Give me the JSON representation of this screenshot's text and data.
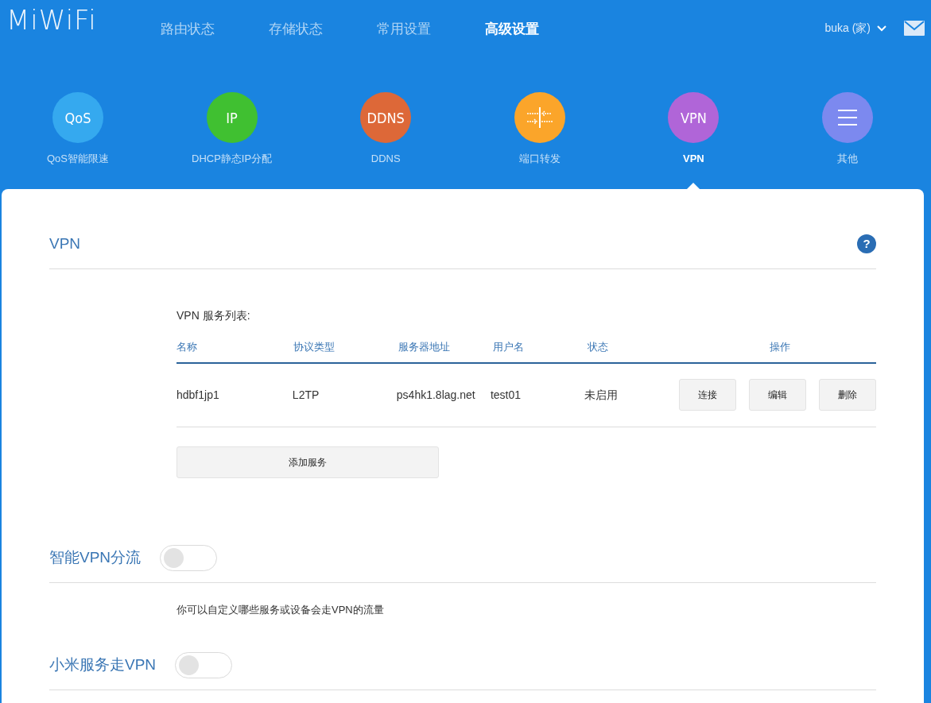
{
  "header": {
    "logo": "MiWiFi",
    "nav": [
      {
        "label": "路由状态",
        "selected": false
      },
      {
        "label": "存储状态",
        "selected": false
      },
      {
        "label": "常用设置",
        "selected": false
      },
      {
        "label": "高级设置",
        "selected": true
      }
    ],
    "user": "buka (家)"
  },
  "features": [
    {
      "kind": "text",
      "glyph": "QoS",
      "label": "QoS智能限速",
      "color": "#35a9ef",
      "selected": false
    },
    {
      "kind": "text",
      "glyph": "IP",
      "label": "DHCP静态IP分配",
      "color": "#40c031",
      "selected": false
    },
    {
      "kind": "text",
      "glyph": "DDNS",
      "label": "DDNS",
      "color": "#dd6838",
      "selected": false
    },
    {
      "kind": "ports",
      "label": "端口转发",
      "color": "#fba52a",
      "selected": false
    },
    {
      "kind": "text",
      "glyph": "VPN",
      "label": "VPN",
      "color": "#b065d8",
      "selected": true
    },
    {
      "kind": "menu",
      "label": "其他",
      "color": "#7c89ef",
      "selected": false
    }
  ],
  "vpn": {
    "title": "VPN",
    "help": "?",
    "list_title": "VPN 服务列表:",
    "columns": [
      "名称",
      "协议类型",
      "服务器地址",
      "用户名",
      "状态",
      "操作"
    ],
    "rows": [
      {
        "name": "hdbf1jp1",
        "protocol": "L2TP",
        "server": "ps4hk1.8lag.net",
        "user": "test01",
        "status": "未启用",
        "actions": [
          "连接",
          "编辑",
          "删除"
        ]
      }
    ],
    "add_button": "添加服务"
  },
  "toggles": [
    {
      "label": "智能VPN分流",
      "on": false,
      "description": "你可以自定义哪些服务或设备会走VPN的流量"
    },
    {
      "label": "小米服务走VPN",
      "on": false
    }
  ]
}
